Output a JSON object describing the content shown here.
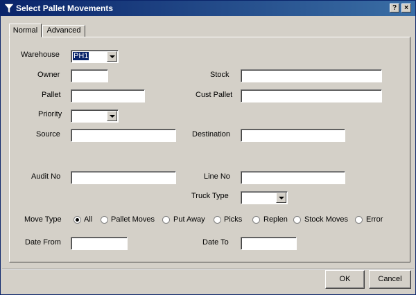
{
  "window": {
    "title": "Select Pallet Movements",
    "help_label": "?",
    "close_label": "×",
    "titlebar_color": "#0a246a",
    "icon": "filter-funnel-icon"
  },
  "tabs": [
    {
      "label": "Normal",
      "active": true
    },
    {
      "label": "Advanced",
      "active": false
    }
  ],
  "form": {
    "warehouse": {
      "label": "Warehouse",
      "value": "PH1"
    },
    "owner": {
      "label": "Owner",
      "value": ""
    },
    "stock": {
      "label": "Stock",
      "value": ""
    },
    "pallet": {
      "label": "Pallet",
      "value": ""
    },
    "cust_pallet": {
      "label": "Cust Pallet",
      "value": ""
    },
    "priority": {
      "label": "Priority",
      "value": ""
    },
    "source": {
      "label": "Source",
      "value": ""
    },
    "destination": {
      "label": "Destination",
      "value": ""
    },
    "audit_no": {
      "label": "Audit No",
      "value": ""
    },
    "line_no": {
      "label": "Line No",
      "value": ""
    },
    "truck_type": {
      "label": "Truck Type",
      "value": ""
    },
    "move_type": {
      "label": "Move Type",
      "selected": "All",
      "options": [
        "All",
        "Pallet Moves",
        "Put Away",
        "Picks",
        "Replen",
        "Stock Moves",
        "Error"
      ]
    },
    "date_from": {
      "label": "Date From",
      "value": ""
    },
    "date_to": {
      "label": "Date To",
      "value": ""
    }
  },
  "buttons": {
    "ok": "OK",
    "cancel": "Cancel"
  }
}
